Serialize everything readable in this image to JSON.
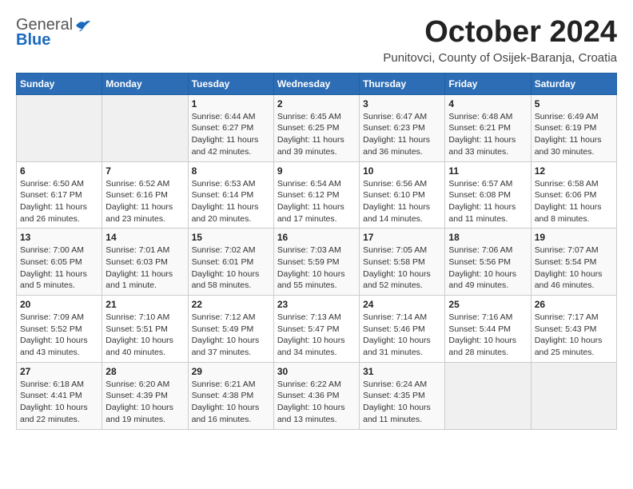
{
  "header": {
    "logo": {
      "general": "General",
      "blue": "Blue"
    },
    "title": "October 2024",
    "subtitle": "Punitovci, County of Osijek-Baranja, Croatia"
  },
  "weekdays": [
    "Sunday",
    "Monday",
    "Tuesday",
    "Wednesday",
    "Thursday",
    "Friday",
    "Saturday"
  ],
  "weeks": [
    [
      {
        "day": "",
        "sunrise": "",
        "sunset": "",
        "daylight": ""
      },
      {
        "day": "",
        "sunrise": "",
        "sunset": "",
        "daylight": ""
      },
      {
        "day": "1",
        "sunrise": "Sunrise: 6:44 AM",
        "sunset": "Sunset: 6:27 PM",
        "daylight": "Daylight: 11 hours and 42 minutes."
      },
      {
        "day": "2",
        "sunrise": "Sunrise: 6:45 AM",
        "sunset": "Sunset: 6:25 PM",
        "daylight": "Daylight: 11 hours and 39 minutes."
      },
      {
        "day": "3",
        "sunrise": "Sunrise: 6:47 AM",
        "sunset": "Sunset: 6:23 PM",
        "daylight": "Daylight: 11 hours and 36 minutes."
      },
      {
        "day": "4",
        "sunrise": "Sunrise: 6:48 AM",
        "sunset": "Sunset: 6:21 PM",
        "daylight": "Daylight: 11 hours and 33 minutes."
      },
      {
        "day": "5",
        "sunrise": "Sunrise: 6:49 AM",
        "sunset": "Sunset: 6:19 PM",
        "daylight": "Daylight: 11 hours and 30 minutes."
      }
    ],
    [
      {
        "day": "6",
        "sunrise": "Sunrise: 6:50 AM",
        "sunset": "Sunset: 6:17 PM",
        "daylight": "Daylight: 11 hours and 26 minutes."
      },
      {
        "day": "7",
        "sunrise": "Sunrise: 6:52 AM",
        "sunset": "Sunset: 6:16 PM",
        "daylight": "Daylight: 11 hours and 23 minutes."
      },
      {
        "day": "8",
        "sunrise": "Sunrise: 6:53 AM",
        "sunset": "Sunset: 6:14 PM",
        "daylight": "Daylight: 11 hours and 20 minutes."
      },
      {
        "day": "9",
        "sunrise": "Sunrise: 6:54 AM",
        "sunset": "Sunset: 6:12 PM",
        "daylight": "Daylight: 11 hours and 17 minutes."
      },
      {
        "day": "10",
        "sunrise": "Sunrise: 6:56 AM",
        "sunset": "Sunset: 6:10 PM",
        "daylight": "Daylight: 11 hours and 14 minutes."
      },
      {
        "day": "11",
        "sunrise": "Sunrise: 6:57 AM",
        "sunset": "Sunset: 6:08 PM",
        "daylight": "Daylight: 11 hours and 11 minutes."
      },
      {
        "day": "12",
        "sunrise": "Sunrise: 6:58 AM",
        "sunset": "Sunset: 6:06 PM",
        "daylight": "Daylight: 11 hours and 8 minutes."
      }
    ],
    [
      {
        "day": "13",
        "sunrise": "Sunrise: 7:00 AM",
        "sunset": "Sunset: 6:05 PM",
        "daylight": "Daylight: 11 hours and 5 minutes."
      },
      {
        "day": "14",
        "sunrise": "Sunrise: 7:01 AM",
        "sunset": "Sunset: 6:03 PM",
        "daylight": "Daylight: 11 hours and 1 minute."
      },
      {
        "day": "15",
        "sunrise": "Sunrise: 7:02 AM",
        "sunset": "Sunset: 6:01 PM",
        "daylight": "Daylight: 10 hours and 58 minutes."
      },
      {
        "day": "16",
        "sunrise": "Sunrise: 7:03 AM",
        "sunset": "Sunset: 5:59 PM",
        "daylight": "Daylight: 10 hours and 55 minutes."
      },
      {
        "day": "17",
        "sunrise": "Sunrise: 7:05 AM",
        "sunset": "Sunset: 5:58 PM",
        "daylight": "Daylight: 10 hours and 52 minutes."
      },
      {
        "day": "18",
        "sunrise": "Sunrise: 7:06 AM",
        "sunset": "Sunset: 5:56 PM",
        "daylight": "Daylight: 10 hours and 49 minutes."
      },
      {
        "day": "19",
        "sunrise": "Sunrise: 7:07 AM",
        "sunset": "Sunset: 5:54 PM",
        "daylight": "Daylight: 10 hours and 46 minutes."
      }
    ],
    [
      {
        "day": "20",
        "sunrise": "Sunrise: 7:09 AM",
        "sunset": "Sunset: 5:52 PM",
        "daylight": "Daylight: 10 hours and 43 minutes."
      },
      {
        "day": "21",
        "sunrise": "Sunrise: 7:10 AM",
        "sunset": "Sunset: 5:51 PM",
        "daylight": "Daylight: 10 hours and 40 minutes."
      },
      {
        "day": "22",
        "sunrise": "Sunrise: 7:12 AM",
        "sunset": "Sunset: 5:49 PM",
        "daylight": "Daylight: 10 hours and 37 minutes."
      },
      {
        "day": "23",
        "sunrise": "Sunrise: 7:13 AM",
        "sunset": "Sunset: 5:47 PM",
        "daylight": "Daylight: 10 hours and 34 minutes."
      },
      {
        "day": "24",
        "sunrise": "Sunrise: 7:14 AM",
        "sunset": "Sunset: 5:46 PM",
        "daylight": "Daylight: 10 hours and 31 minutes."
      },
      {
        "day": "25",
        "sunrise": "Sunrise: 7:16 AM",
        "sunset": "Sunset: 5:44 PM",
        "daylight": "Daylight: 10 hours and 28 minutes."
      },
      {
        "day": "26",
        "sunrise": "Sunrise: 7:17 AM",
        "sunset": "Sunset: 5:43 PM",
        "daylight": "Daylight: 10 hours and 25 minutes."
      }
    ],
    [
      {
        "day": "27",
        "sunrise": "Sunrise: 6:18 AM",
        "sunset": "Sunset: 4:41 PM",
        "daylight": "Daylight: 10 hours and 22 minutes."
      },
      {
        "day": "28",
        "sunrise": "Sunrise: 6:20 AM",
        "sunset": "Sunset: 4:39 PM",
        "daylight": "Daylight: 10 hours and 19 minutes."
      },
      {
        "day": "29",
        "sunrise": "Sunrise: 6:21 AM",
        "sunset": "Sunset: 4:38 PM",
        "daylight": "Daylight: 10 hours and 16 minutes."
      },
      {
        "day": "30",
        "sunrise": "Sunrise: 6:22 AM",
        "sunset": "Sunset: 4:36 PM",
        "daylight": "Daylight: 10 hours and 13 minutes."
      },
      {
        "day": "31",
        "sunrise": "Sunrise: 6:24 AM",
        "sunset": "Sunset: 4:35 PM",
        "daylight": "Daylight: 10 hours and 11 minutes."
      },
      {
        "day": "",
        "sunrise": "",
        "sunset": "",
        "daylight": ""
      },
      {
        "day": "",
        "sunrise": "",
        "sunset": "",
        "daylight": ""
      }
    ]
  ]
}
